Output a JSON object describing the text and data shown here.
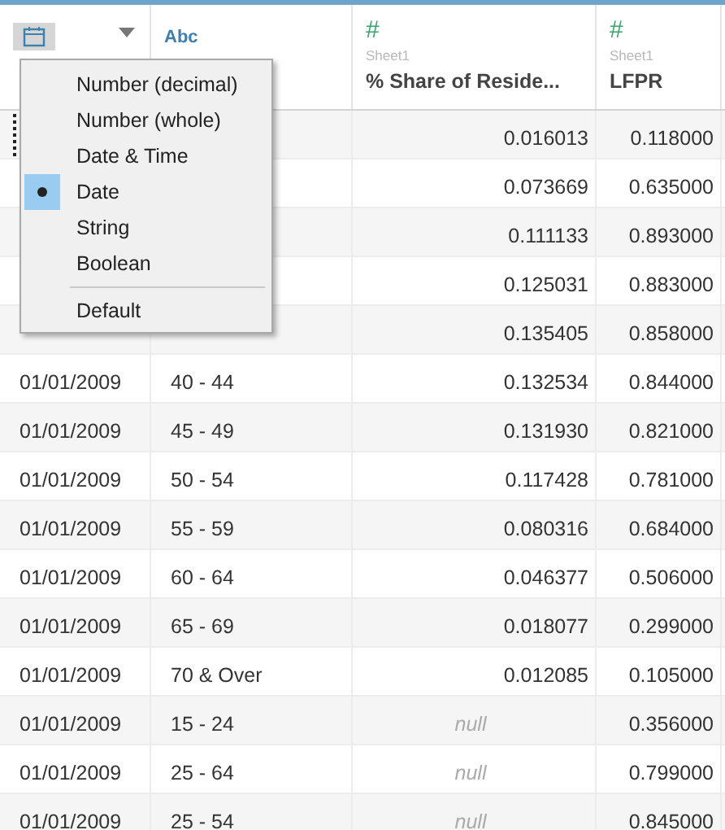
{
  "columns": [
    {
      "kind": "date"
    },
    {
      "kind": "string",
      "type_label": "Abc"
    },
    {
      "kind": "number",
      "type_label": "#",
      "source": "Sheet1",
      "name": "% Share of Reside..."
    },
    {
      "kind": "number",
      "type_label": "#",
      "source": "Sheet1",
      "name": "LFPR"
    }
  ],
  "rows": [
    {
      "share": "0.016013",
      "lfpr": "0.118000",
      "share_null": false,
      "focused": true
    },
    {
      "share": "0.073669",
      "lfpr": "0.635000",
      "share_null": false,
      "focused": false
    },
    {
      "share": "0.111133",
      "lfpr": "0.893000",
      "share_null": false,
      "focused": false
    },
    {
      "share": "0.125031",
      "lfpr": "0.883000",
      "share_null": false,
      "focused": false
    },
    {
      "share": "0.135405",
      "lfpr": "0.858000",
      "share_null": false,
      "focused": false
    },
    {
      "date": "01/01/2009",
      "age": "40 - 44",
      "share": "0.132534",
      "lfpr": "0.844000",
      "share_null": false,
      "focused": false
    },
    {
      "date": "01/01/2009",
      "age": "45 - 49",
      "share": "0.131930",
      "lfpr": "0.821000",
      "share_null": false,
      "focused": false
    },
    {
      "date": "01/01/2009",
      "age": "50 - 54",
      "share": "0.117428",
      "lfpr": "0.781000",
      "share_null": false,
      "focused": false
    },
    {
      "date": "01/01/2009",
      "age": "55 - 59",
      "share": "0.080316",
      "lfpr": "0.684000",
      "share_null": false,
      "focused": false
    },
    {
      "date": "01/01/2009",
      "age": "60 - 64",
      "share": "0.046377",
      "lfpr": "0.506000",
      "share_null": false,
      "focused": false
    },
    {
      "date": "01/01/2009",
      "age": "65 - 69",
      "share": "0.018077",
      "lfpr": "0.299000",
      "share_null": false,
      "focused": false
    },
    {
      "date": "01/01/2009",
      "age": "70 & Over",
      "share": "0.012085",
      "lfpr": "0.105000",
      "share_null": false,
      "focused": false
    },
    {
      "date": "01/01/2009",
      "age": "15 - 24",
      "share": "null",
      "lfpr": "0.356000",
      "share_null": true,
      "focused": false
    },
    {
      "date": "01/01/2009",
      "age": "25 - 64",
      "share": "null",
      "lfpr": "0.799000",
      "share_null": true,
      "focused": false
    },
    {
      "date": "01/01/2009",
      "age": "25 - 54",
      "share": "null",
      "lfpr": "0.845000",
      "share_null": true,
      "focused": false
    }
  ],
  "type_menu": {
    "items": [
      {
        "kind": "option",
        "label": "Number (decimal)",
        "selected": false
      },
      {
        "kind": "option",
        "label": "Number (whole)",
        "selected": false
      },
      {
        "kind": "option",
        "label": "Date & Time",
        "selected": false
      },
      {
        "kind": "option",
        "label": "Date",
        "selected": true
      },
      {
        "kind": "option",
        "label": "String",
        "selected": false
      },
      {
        "kind": "option",
        "label": "Boolean",
        "selected": false
      },
      {
        "kind": "separator"
      },
      {
        "kind": "option",
        "label": "Default",
        "selected": false
      }
    ]
  }
}
